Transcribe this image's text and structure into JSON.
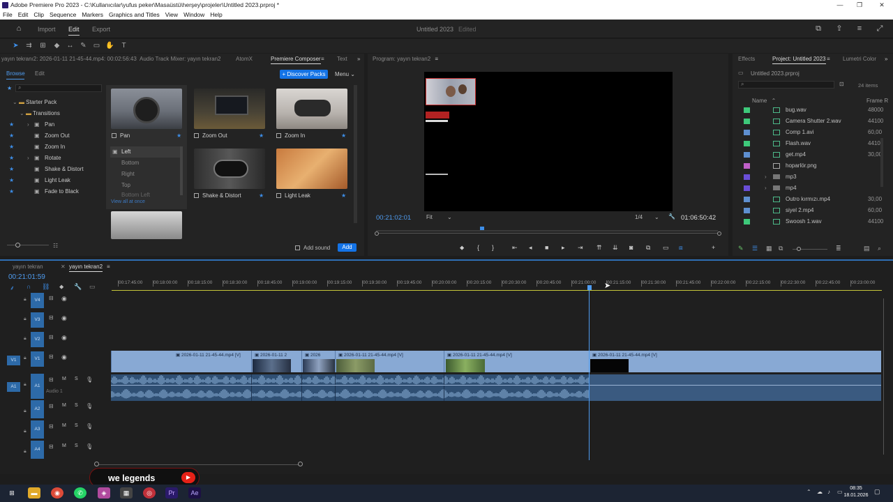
{
  "window": {
    "title": "Adobe Premiere Pro 2023 - C:\\Kullanıcılar\\yufus peker\\Masaüstü\\herşey\\projeler\\Untitled 2023.prproj *",
    "min": "—",
    "max": "❐",
    "close": "✕"
  },
  "menu": [
    "File",
    "Edit",
    "Clip",
    "Sequence",
    "Markers",
    "Graphics and Titles",
    "View",
    "Window",
    "Help"
  ],
  "header": {
    "workspaces": [
      "Import",
      "Edit",
      "Export"
    ],
    "active": "Edit",
    "project_name": "Untitled 2023",
    "project_status": "Edited"
  },
  "source_tabs": {
    "source": "yayın tekranı2: 2026-01-11 21-45-44.mp4: 00:02:56:43",
    "audio_mixer": "Audio Track Mixer: yayın tekran2",
    "atomx": "AtomX",
    "composer": "Premiere Composer",
    "text": "Text"
  },
  "composer": {
    "subtabs": [
      "Browse",
      "Edit"
    ],
    "discover": "+ Discover Packs",
    "menu": "Menu",
    "tree": {
      "pack": "Starter Pack",
      "folder": "Transitions",
      "items": [
        "Pan",
        "Zoom Out",
        "Zoom In",
        "Rotate",
        "Shake & Distort",
        "Light Leak",
        "Fade to Black"
      ]
    },
    "cards": [
      "Pan",
      "Zoom Out",
      "Zoom In",
      "Shake & Distort",
      "Light Leak"
    ],
    "pan_options": [
      "Left",
      "Bottom",
      "Right",
      "Top",
      "Bottom Left"
    ],
    "view_all": "View all at once",
    "add_sound": "Add sound",
    "add": "Add"
  },
  "program": {
    "title": "Program: yayın tekran2",
    "timecode": "00:21:02:01",
    "fit": "Fit",
    "quality": "1/4",
    "duration": "01:06:50:42"
  },
  "project": {
    "tabs": [
      "Effects",
      "Project: Untitled 2023",
      "Lumetri Color"
    ],
    "file": "Untitled 2023.prproj",
    "items_count": "24 items",
    "col_name": "Name",
    "col_frame": "Frame R",
    "rows": [
      {
        "name": "bug.wav",
        "fr": "48000",
        "color": "#3ec97a",
        "type": "audio"
      },
      {
        "name": "Camera Shutter 2.wav",
        "fr": "44100",
        "color": "#3ec97a",
        "type": "audio"
      },
      {
        "name": "Comp 1.avi",
        "fr": "60,00",
        "color": "#5e8fd0",
        "type": "video"
      },
      {
        "name": "Flash.wav",
        "fr": "44100",
        "color": "#3ec97a",
        "type": "audio"
      },
      {
        "name": "get.mp4",
        "fr": "30,00",
        "color": "#5e8fd0",
        "type": "video"
      },
      {
        "name": "hoparlör.png",
        "fr": "",
        "color": "#c060c8",
        "type": "image"
      },
      {
        "name": "mp3",
        "fr": "",
        "color": "#6a4ed8",
        "type": "folder"
      },
      {
        "name": "mp4",
        "fr": "",
        "color": "#6a4ed8",
        "type": "folder"
      },
      {
        "name": "Outro kırmızı.mp4",
        "fr": "30,00",
        "color": "#5e8fd0",
        "type": "video"
      },
      {
        "name": "siyel 2.mp4",
        "fr": "60,00",
        "color": "#5e8fd0",
        "type": "video"
      },
      {
        "name": "Swoosh 1.wav",
        "fr": "44100",
        "color": "#3ec97a",
        "type": "audio"
      }
    ]
  },
  "timeline": {
    "tabs": [
      "yayın tekran",
      "yayın tekran2"
    ],
    "timecode": "00:21:01:59",
    "ruler": [
      "00:17:45:00",
      "00:18:00:00",
      "00:18:15:00",
      "00:18:30:00",
      "00:18:45:00",
      "00:19:00:00",
      "00:19:15:00",
      "00:19:30:00",
      "00:19:45:00",
      "00:20:00:00",
      "00:20:15:00",
      "00:20:30:00",
      "00:20:45:00",
      "00:21:00:00",
      "00:21:15:00",
      "00:21:30:00",
      "00:21:45:00",
      "00:22:00:00",
      "00:22:15:00",
      "00:22:30:00",
      "00:22:45:00",
      "00:23:00:00"
    ],
    "video_tracks": [
      "V4",
      "V3",
      "V2",
      "V1"
    ],
    "audio_tracks": [
      "A1",
      "A2",
      "A3",
      "A4"
    ],
    "audio1_name": "Audio 1",
    "src_v": "V1",
    "src_a": "A1",
    "clip_label": "2026-01-11 21-45-44.mp4 [V]",
    "clip_short": "2026-01-11 2",
    "clip_short2": "2026"
  },
  "overlay": {
    "text": "we legends"
  },
  "taskbar": {
    "time": "08:35",
    "date": "18.01.2026"
  }
}
